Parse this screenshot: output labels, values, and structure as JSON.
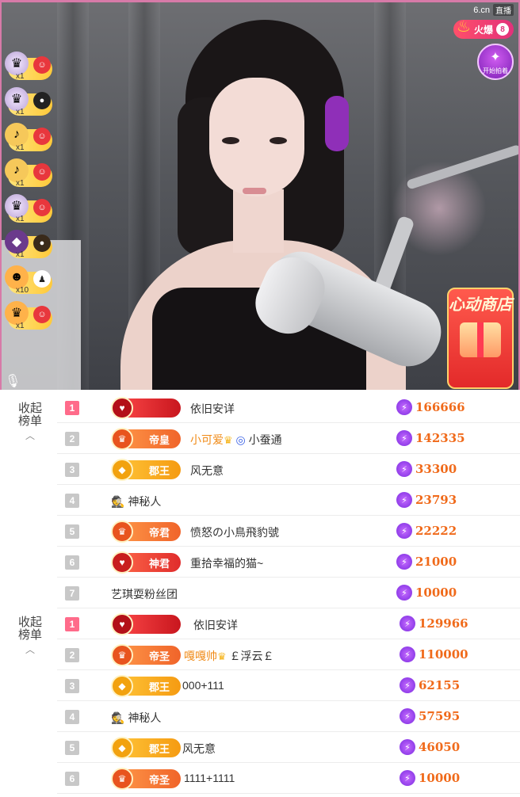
{
  "stream": {
    "site": "6.cn",
    "live_label": "直播",
    "hot_label": "火爆",
    "hot_level": "8",
    "guard_label": "开始拍着",
    "shop_title": "心动商店"
  },
  "gift_feed": [
    {
      "count": "x1"
    },
    {
      "count": "x1"
    },
    {
      "count": "x1"
    },
    {
      "count": "x1"
    },
    {
      "count": "x1"
    },
    {
      "count": "x1"
    },
    {
      "count": "x10"
    },
    {
      "count": "x1"
    }
  ],
  "collapse_label_1": "收起榜单",
  "collapse_label_2": "收起榜单",
  "list_1": [
    {
      "rank": "1",
      "badge": "",
      "badge_style": "crimson",
      "name": "依旧安详",
      "score": "166666"
    },
    {
      "rank": "2",
      "badge": "帝皇",
      "badge_style": "orange",
      "name": "小可爱",
      "extra": "小蚕通",
      "score": "142335"
    },
    {
      "rank": "3",
      "badge": "郡王",
      "badge_style": "gold",
      "name": "风无意",
      "score": "33300"
    },
    {
      "rank": "4",
      "badge": "",
      "badge_style": "",
      "name": "神秘人",
      "score": "23793"
    },
    {
      "rank": "5",
      "badge": "帝君",
      "badge_style": "orange",
      "name": "愤怒の小鳥飛豹號",
      "score": "22222"
    },
    {
      "rank": "6",
      "badge": "神君",
      "badge_style": "red",
      "name": "重拾幸福的猫~",
      "score": "21000"
    },
    {
      "rank": "7",
      "badge": "",
      "badge_style": "",
      "name": "艺琪耍粉丝团",
      "score": "10000"
    }
  ],
  "list_2": [
    {
      "rank": "1",
      "badge": "",
      "badge_style": "crimson",
      "name": "依旧安详",
      "score": "129966"
    },
    {
      "rank": "2",
      "badge": "帝圣",
      "badge_style": "orange",
      "name": "嘎嘎帅",
      "extra": "￡浮云￡",
      "score": "110000"
    },
    {
      "rank": "3",
      "badge": "郡王",
      "badge_style": "gold",
      "name": "000+111",
      "score": "62155"
    },
    {
      "rank": "4",
      "badge": "",
      "badge_style": "",
      "name": "神秘人",
      "score": "57595"
    },
    {
      "rank": "5",
      "badge": "郡王",
      "badge_style": "gold",
      "name": "风无意",
      "score": "46050"
    },
    {
      "rank": "6",
      "badge": "帝圣",
      "badge_style": "orange",
      "name": "1111+1111",
      "score": "10000"
    }
  ]
}
